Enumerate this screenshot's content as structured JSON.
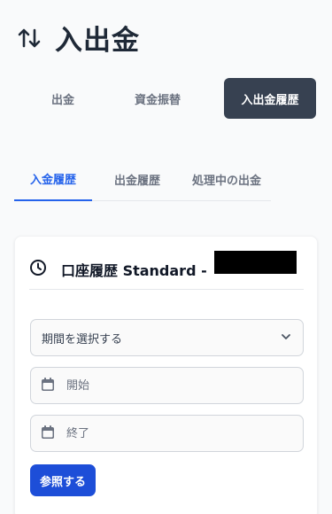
{
  "header": {
    "title": "入出金",
    "icon": "arrow-up-down-icon"
  },
  "top_tabs": [
    {
      "label": "出金",
      "active": false
    },
    {
      "label": "資金振替",
      "active": false
    },
    {
      "label": "入出金履歴",
      "active": true
    }
  ],
  "sub_tabs": [
    {
      "label": "入金履歴",
      "active": true
    },
    {
      "label": "出金履歴",
      "active": false
    },
    {
      "label": "処理中の出金",
      "active": false
    }
  ],
  "card": {
    "icon": "clock-icon",
    "title": "口座履歴 Standard -",
    "period_select": {
      "value": "期間を選択する",
      "icon": "chevron-down-icon"
    },
    "start_date": {
      "placeholder": "開始",
      "value": "",
      "icon": "calendar-icon"
    },
    "end_date": {
      "placeholder": "終了",
      "value": "",
      "icon": "calendar-icon"
    },
    "submit_label": "参照する"
  },
  "colors": {
    "accent": "#2563eb",
    "button": "#1d4ed8",
    "active_pill": "#374151",
    "background": "#f9fafb"
  }
}
